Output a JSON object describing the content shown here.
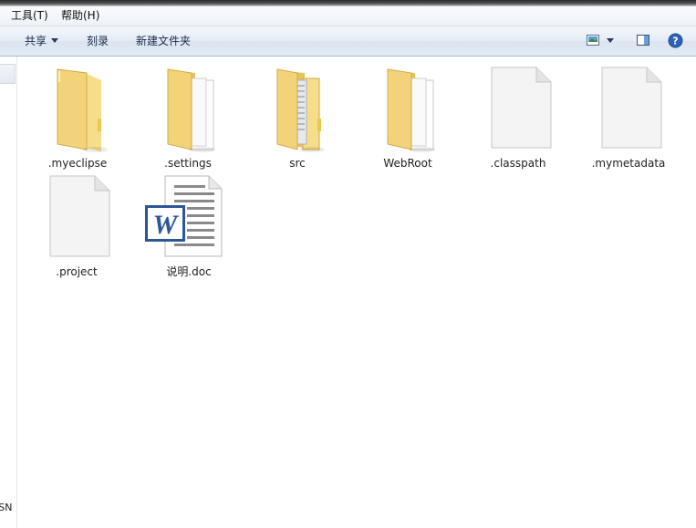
{
  "menubar": {
    "tools_label": "工具(T)",
    "help_label": "帮助(H)"
  },
  "toolbar": {
    "share_label": "共享",
    "burn_label": "刻录",
    "new_folder_label": "新建文件夹",
    "icons": [
      "view-options-icon",
      "chevron-down-icon",
      "preview-pane-icon",
      "help-icon"
    ]
  },
  "sidebar": {
    "clipped_text": "ISN"
  },
  "files": [
    {
      "name": ".myeclipse",
      "icon": "folder-icon"
    },
    {
      "name": ".settings",
      "icon": "folder-with-documents-icon"
    },
    {
      "name": "src",
      "icon": "folder-with-files-icon"
    },
    {
      "name": "WebRoot",
      "icon": "folder-with-documents-icon"
    },
    {
      "name": ".classpath",
      "icon": "blank-file-icon"
    },
    {
      "name": ".mymetadata",
      "icon": "blank-file-icon"
    },
    {
      "name": ".project",
      "icon": "blank-file-icon"
    },
    {
      "name": "说明.doc",
      "icon": "word-document-icon"
    }
  ],
  "colors": {
    "folder_yellow": "#f3d37a",
    "word_blue": "#2b5797",
    "toolbar_text": "#1a2b4a"
  }
}
